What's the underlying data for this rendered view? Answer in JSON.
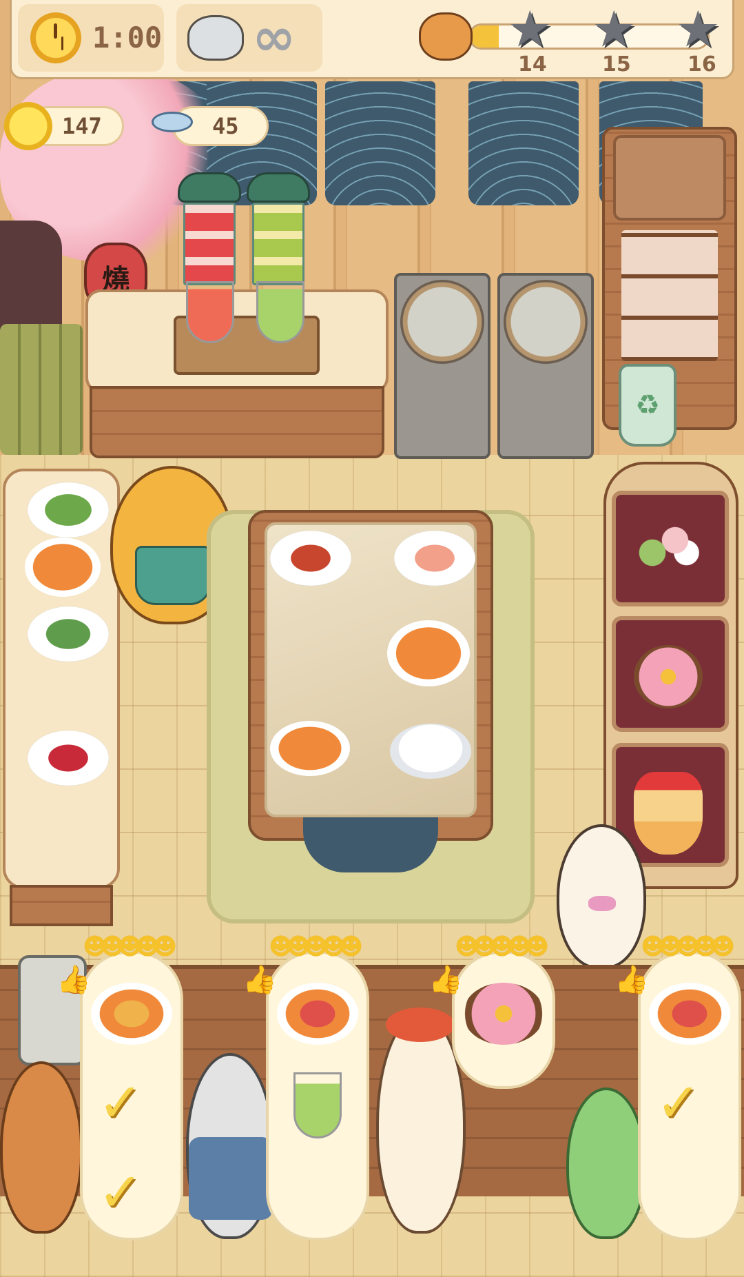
{
  "hud": {
    "timer": "1:00",
    "customer_limit_symbol": "∞",
    "star_levels": [
      "14",
      "15",
      "16"
    ],
    "level_progress": 0.12
  },
  "currency": {
    "coins": "147",
    "fish": "45"
  },
  "lantern_text": "燒",
  "icons": {
    "timer": "clock-icon",
    "customers": "cat-head-icon",
    "coin": "paw-coin-icon",
    "fish": "fish-icon",
    "progress": "shiba-head-icon",
    "star": "star-icon",
    "recycle": "recycle-icon"
  },
  "stations": {
    "blenders": [
      "strawberry-blender",
      "avocado-blender"
    ],
    "juices": [
      "strawberry-juice",
      "avocado-juice"
    ],
    "fryers": [
      "fryer-1",
      "fryer-2"
    ],
    "ingredients_left": [
      "lettuce",
      "fried-shrimp-bowl",
      "cucumber",
      "radish"
    ],
    "prep_table": [
      "sausages",
      "shrimp",
      "octopus-salad-bowl",
      "sauce-dish",
      "empty-bowl"
    ],
    "dessert_shelf": [
      "dango-skewer",
      "flower-mochi",
      "strawberry-taiyaki-parfait"
    ]
  },
  "orders": [
    {
      "customer": "fox",
      "mood": 5,
      "items": [
        "fried-shrimp-bowl",
        "done",
        "done"
      ]
    },
    {
      "customer": "grey-cat",
      "mood": 5,
      "items": [
        "octopus-salad-bowl",
        "avocado-juice"
      ]
    },
    {
      "customer": "alpaca",
      "mood": 5,
      "items": [
        "flower-mochi"
      ]
    },
    {
      "customer": "frog",
      "mood": 5,
      "items": [
        "octopus-salad-bowl",
        "done"
      ]
    }
  ],
  "colors": {
    "progress_fill": "#f5c33b",
    "star_empty": "#6d7177",
    "banner": "#3f5a6c"
  }
}
